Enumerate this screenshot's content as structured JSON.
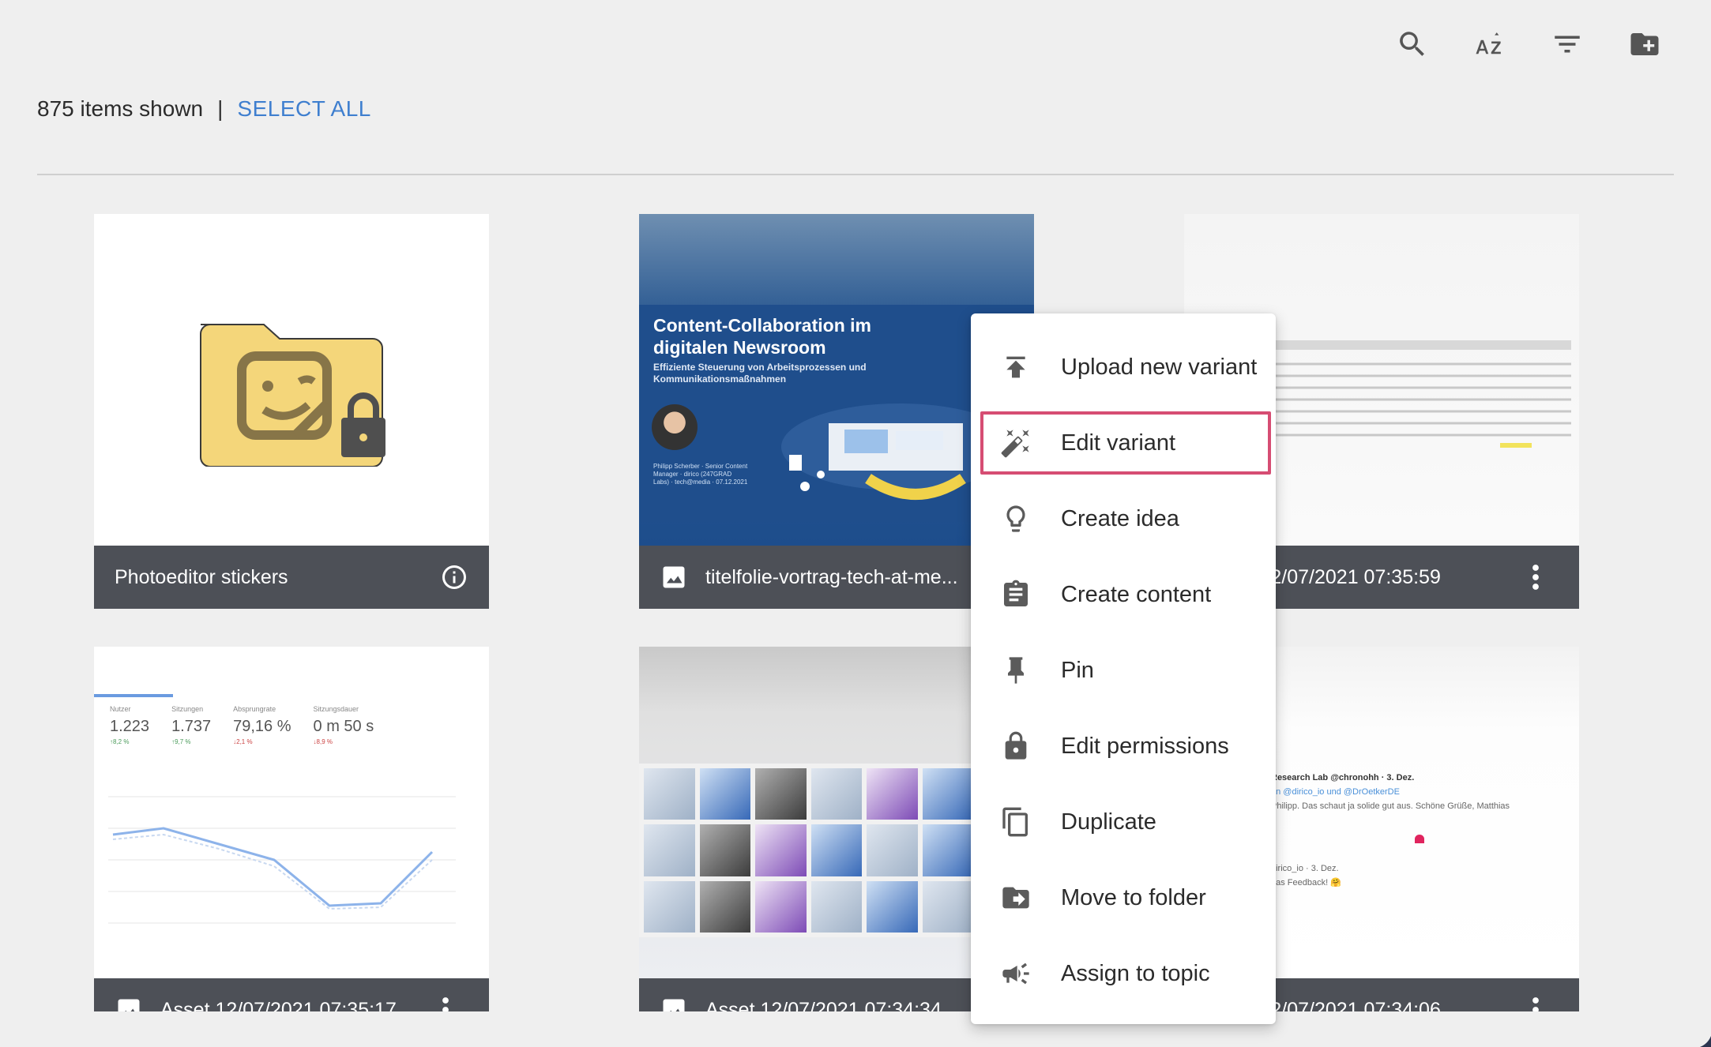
{
  "toolbar": {
    "icons": [
      "search-icon",
      "sort-az-icon",
      "filter-icon",
      "new-folder-icon"
    ]
  },
  "summary": {
    "count_text": "875 items shown",
    "separator": "|",
    "select_all": "SELECT ALL"
  },
  "cards": [
    {
      "name": "Photoeditor stickers",
      "type": "folder",
      "footer_icon": "info-icon"
    },
    {
      "name": "titelfolie-vortrag-tech-at-me...",
      "type": "image",
      "footer_icon": "image-icon",
      "slide": {
        "title": "Content-Collaboration im digitalen Newsroom",
        "subtitle": "Effiziente Steuerung von Arbeitsprozessen und Kommunikationsmaßnahmen",
        "meta": "Philipp Scherber · Senior Content Manager · dirico (247GRAD Labs) · tech@media · 07.12.2021"
      }
    },
    {
      "name": "Asset 12/07/2021 07:35:59",
      "type": "image",
      "footer_icon": "more-vert-icon"
    },
    {
      "name": "Asset 12/07/2021 07:35:17",
      "type": "image",
      "footer_icon": "image-icon",
      "metrics": [
        {
          "label": "Nutzer",
          "value": "1.223",
          "change": "↑8,2 %"
        },
        {
          "label": "Sitzungen",
          "value": "1.737",
          "change": "↑9,7 %"
        },
        {
          "label": "Absprungrate",
          "value": "79,16 %",
          "change": "↓2,1 %"
        },
        {
          "label": "Sitzungsdauer",
          "value": "0 m 50 s",
          "change": "↓8,9 %"
        }
      ]
    },
    {
      "name": "Asset 12/07/2021 07:34:34",
      "type": "image",
      "footer_icon": "image-icon"
    },
    {
      "name": "Asset 12/07/2021 07:34:06",
      "type": "image",
      "footer_icon": "more-vert-icon",
      "tweet": {
        "line1": "Research Lab @chronohh · 3. Dez.",
        "line2": "an @dirico_io und @DrOetkerDE",
        "line3": "Philipp. Das schaut ja solide gut aus. Schöne Grüße, Matthias",
        "line4": "dirico_io · 3. Dez.",
        "line5": "das Feedback! 🤗"
      }
    }
  ],
  "context_menu": {
    "items": [
      {
        "label": "Upload new variant",
        "icon": "upload-icon"
      },
      {
        "label": "Edit variant",
        "icon": "magic-wand-icon",
        "highlighted": true
      },
      {
        "label": "Create idea",
        "icon": "lightbulb-icon"
      },
      {
        "label": "Create content",
        "icon": "clipboard-icon"
      },
      {
        "label": "Pin",
        "icon": "pin-icon"
      },
      {
        "label": "Edit permissions",
        "icon": "lock-icon"
      },
      {
        "label": "Duplicate",
        "icon": "duplicate-icon"
      },
      {
        "label": "Move to folder",
        "icon": "move-to-folder-icon"
      },
      {
        "label": "Assign to topic",
        "icon": "megaphone-icon"
      }
    ]
  },
  "colors": {
    "link": "#3f7fcf",
    "highlight_border": "#d64d73",
    "card_footer": "#4d5057",
    "folder": "#f4d67a"
  }
}
